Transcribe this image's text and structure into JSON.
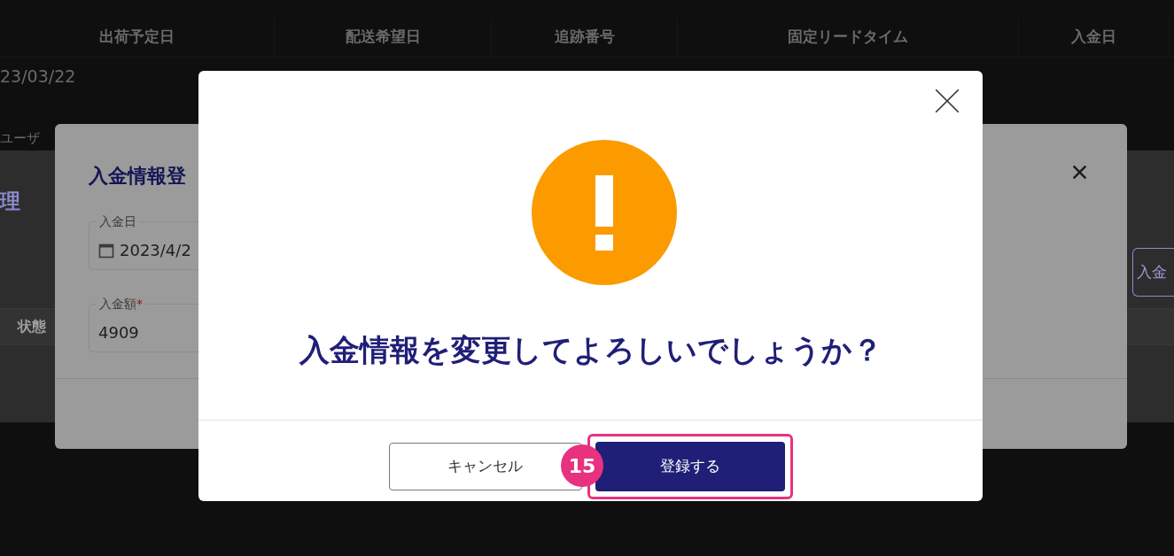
{
  "background_table": {
    "columns": [
      "出荷予定日",
      "配送希望日",
      "追跡番号",
      "固定リードタイム",
      "入金日"
    ],
    "rows": [
      [
        "23/03/22"
      ]
    ]
  },
  "background_page": {
    "tab_label": "ユーザ",
    "heading": "理",
    "column_header": "状態",
    "button": "入金"
  },
  "edit_dialog": {
    "title": "入金情報登",
    "fields": [
      {
        "label": "入金日",
        "value": "2023/4/2",
        "kind": "date"
      },
      {
        "label": "入金額",
        "value": "4909",
        "kind": "number",
        "required_mark": "*"
      }
    ]
  },
  "confirm_dialog": {
    "message": "入金情報を変更してよろしいでしょうか？",
    "buttons": [
      {
        "label": "キャンセル",
        "kind": "secondary",
        "highlighted": false
      },
      {
        "label": "登録する",
        "kind": "primary",
        "highlighted": true
      }
    ],
    "step_badge": "15"
  }
}
